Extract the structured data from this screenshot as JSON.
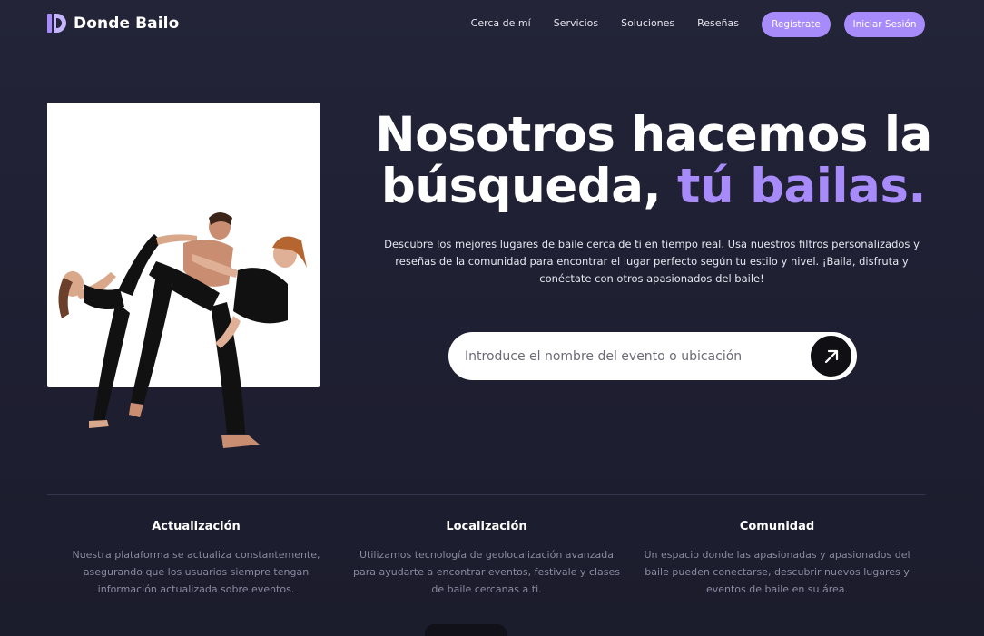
{
  "brand": {
    "name": "Donde Bailo",
    "accent": "#a78bfa"
  },
  "nav": {
    "links": [
      "Cerca de mí",
      "Servicios",
      "Soluciones",
      "Reseñas"
    ],
    "register_label": "Regístrate",
    "login_label": "Iniciar Sesión"
  },
  "hero": {
    "title_line1": "Nosotros hacemos la",
    "title_line2_plain": "búsqueda,",
    "title_line2_accent": "tú bailas.",
    "subtitle": "Descubre los mejores lugares de baile cerca de ti en tiempo real. Usa nuestros filtros personalizados y reseñas de la comunidad para encontrar el lugar perfecto según tu estilo y nivel. ¡Baila, disfruta y conéctate con otros apasionados del baile!"
  },
  "search": {
    "placeholder": "Introduce el nombre del evento o ubicación",
    "button_icon": "arrow-up-right-icon"
  },
  "features": [
    {
      "title": "Actualización",
      "text": "Nuestra plataforma se actualiza constantemente, asegurando que los usuarios siempre tengan información actualizada sobre eventos."
    },
    {
      "title": "Localización",
      "text": "Utilizamos tecnología de geolocalización avanzada para ayudarte a encontrar eventos, festivale y clases de baile cercanas a ti."
    },
    {
      "title": "Comunidad",
      "text": "Un espacio donde las apasionadas y apasionados del baile pueden conectarse, descubrir nuevos lugares y eventos de baile en su área."
    }
  ]
}
